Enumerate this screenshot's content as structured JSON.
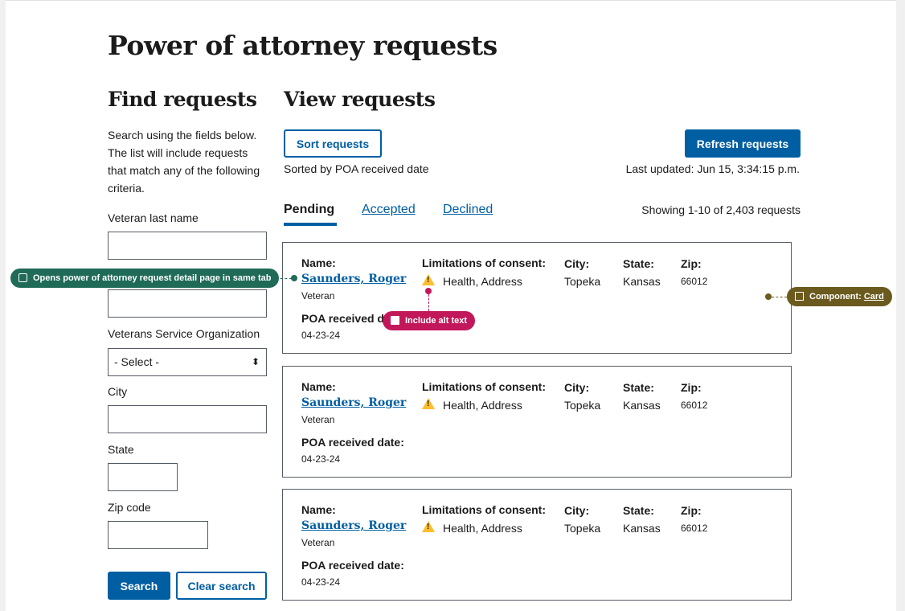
{
  "page_title": "Power of attorney requests",
  "find": {
    "heading": "Find requests",
    "description": "Search using the fields below. The list will include requests that match any of the following criteria.",
    "fields": {
      "last_name_label": "Veteran last name",
      "vso_label": "Veterans Service Organization",
      "vso_selected": "- Select -",
      "city_label": "City",
      "state_label": "State",
      "zip_label": "Zip code"
    },
    "search_label": "Search",
    "clear_label": "Clear search"
  },
  "view": {
    "heading": "View requests",
    "sort_label": "Sort requests",
    "sorted_by": "Sorted by POA received date",
    "refresh_label": "Refresh requests",
    "last_updated": "Last updated: Jun 15, 3:34:15 p.m.",
    "tabs": [
      {
        "label": "Pending"
      },
      {
        "label": "Accepted"
      },
      {
        "label": "Declined"
      }
    ],
    "showing": "Showing 1-10 of 2,403 requests"
  },
  "cards": [
    {
      "name_key": "Name:",
      "name": "Saunders, Roger",
      "role": "Veteran",
      "limits_key": "Limitations of consent:",
      "limits": "Health, Address",
      "city_key": "City:",
      "city": "Topeka",
      "state_key": "State:",
      "state": "Kansas",
      "zip_key": "Zip:",
      "zip": "66012",
      "received_key": "POA received date:",
      "received": "04-23-24"
    },
    {
      "name_key": "Name:",
      "name": "Saunders, Roger",
      "role": "Veteran",
      "limits_key": "Limitations of consent:",
      "limits": "Health, Address",
      "city_key": "City:",
      "city": "Topeka",
      "state_key": "State:",
      "state": "Kansas",
      "zip_key": "Zip:",
      "zip": "66012",
      "received_key": "POA received date:",
      "received": "04-23-24"
    },
    {
      "name_key": "Name:",
      "name": "Saunders, Roger",
      "role": "Veteran",
      "limits_key": "Limitations of consent:",
      "limits": "Health, Address",
      "city_key": "City:",
      "city": "Topeka",
      "state_key": "State:",
      "state": "Kansas",
      "zip_key": "Zip:",
      "zip": "66012",
      "received_key": "POA received date:",
      "received": "04-23-24"
    }
  ],
  "annotations": {
    "link_note": "Opens power of attorney request detail page in same tab",
    "alt_text": "Include alt text",
    "component_prefix": "Component:",
    "component_link": "Card"
  },
  "colors": {
    "primary": "#005ea2",
    "warning": "#ffbe2e",
    "annotation_green": "#1f6b58",
    "annotation_magenta": "#c2185b",
    "annotation_olive": "#6b5a1e"
  },
  "icons": [
    "warning-icon",
    "note-icon",
    "image-icon",
    "component-icon",
    "chevron-updown-icon"
  ]
}
